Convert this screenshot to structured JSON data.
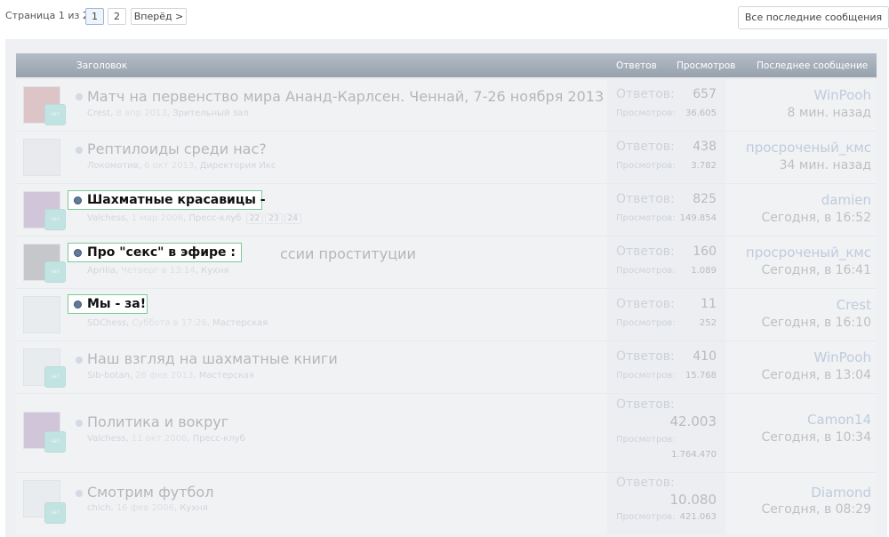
{
  "pagination": {
    "info": "Страница 1 из 2",
    "p1": "1",
    "p2": "2",
    "next": "Вперёд >"
  },
  "latest_button": "Все последние сообщения",
  "header": {
    "title": "Заголовок",
    "replies": "Ответов",
    "views": "Просмотров",
    "last": "Последнее сообщение"
  },
  "labels": {
    "replies": "Ответов:",
    "views": "Просмотров:"
  },
  "threads": [
    {
      "title": "Матч на первенство мира Ананд-Карлсен. Ченнай, 7-26 ноября 2013",
      "author": "Crest",
      "date": "8 апр 2013",
      "forum": "Зрительный зал",
      "replies": "657",
      "views": "36.605",
      "last_user": "WinPooh",
      "last_time": "8 мин. назад"
    },
    {
      "title": "Рептилоиды среди нас?",
      "author": "Локомотив",
      "date": "6 окт 2013",
      "forum": "Директория Икс",
      "replies": "438",
      "views": "3.782",
      "last_user": "просроченый_кмс",
      "last_time": "34 мин. назад"
    },
    {
      "title": "Шахматные красавицы -",
      "author": "Valchess",
      "date": "1 мар 2006",
      "forum": "Пресс-клуб",
      "pages": [
        "22",
        "23",
        "24"
      ],
      "replies": "825",
      "views": "149.854",
      "last_user": "damien",
      "last_time": "Сегодня, в 16:52"
    },
    {
      "title": "Про \"секс\" в эфире : ... России проституции",
      "title_tail": "ссии проституции",
      "author": "Aprilia",
      "date": "Четверг в 13:14",
      "forum": "Кухня",
      "replies": "160",
      "views": "1.089",
      "last_user": "просроченый_кмс",
      "last_time": "Сегодня, в 16:41"
    },
    {
      "title": "Мы - за!",
      "author": "SDChess",
      "date": "Суббота в 17:26",
      "forum": "Мастерская",
      "replies": "11",
      "views": "252",
      "last_user": "Crest",
      "last_time": "Сегодня, в 16:10"
    },
    {
      "title": "Наш взгляд на шахматные книги",
      "author": "Sib-botan",
      "date": "26 фев 2013",
      "forum": "Мастерская",
      "replies": "410",
      "views": "15.768",
      "last_user": "WinPooh",
      "last_time": "Сегодня, в 13:04"
    },
    {
      "title": "Политика и вокруг",
      "author": "Valchess",
      "date": "11 окт 2006",
      "forum": "Пресс-клуб",
      "replies": "42.003",
      "views": "1.764.470",
      "last_user": "Camon14",
      "last_time": "Сегодня, в 10:34"
    },
    {
      "title": "Смотрим футбол",
      "author": "chich",
      "date": "16 фев 2006",
      "forum": "Кухня",
      "replies": "10.080",
      "views": "421.063",
      "last_user": "Diamond",
      "last_time": "Сегодня, в 08:29"
    }
  ],
  "highlights": {
    "h1": "Шахматные красавицы -",
    "h2": "Про \"секс\" в эфире :",
    "h3": "Мы - за!"
  },
  "badge_text": "чат"
}
